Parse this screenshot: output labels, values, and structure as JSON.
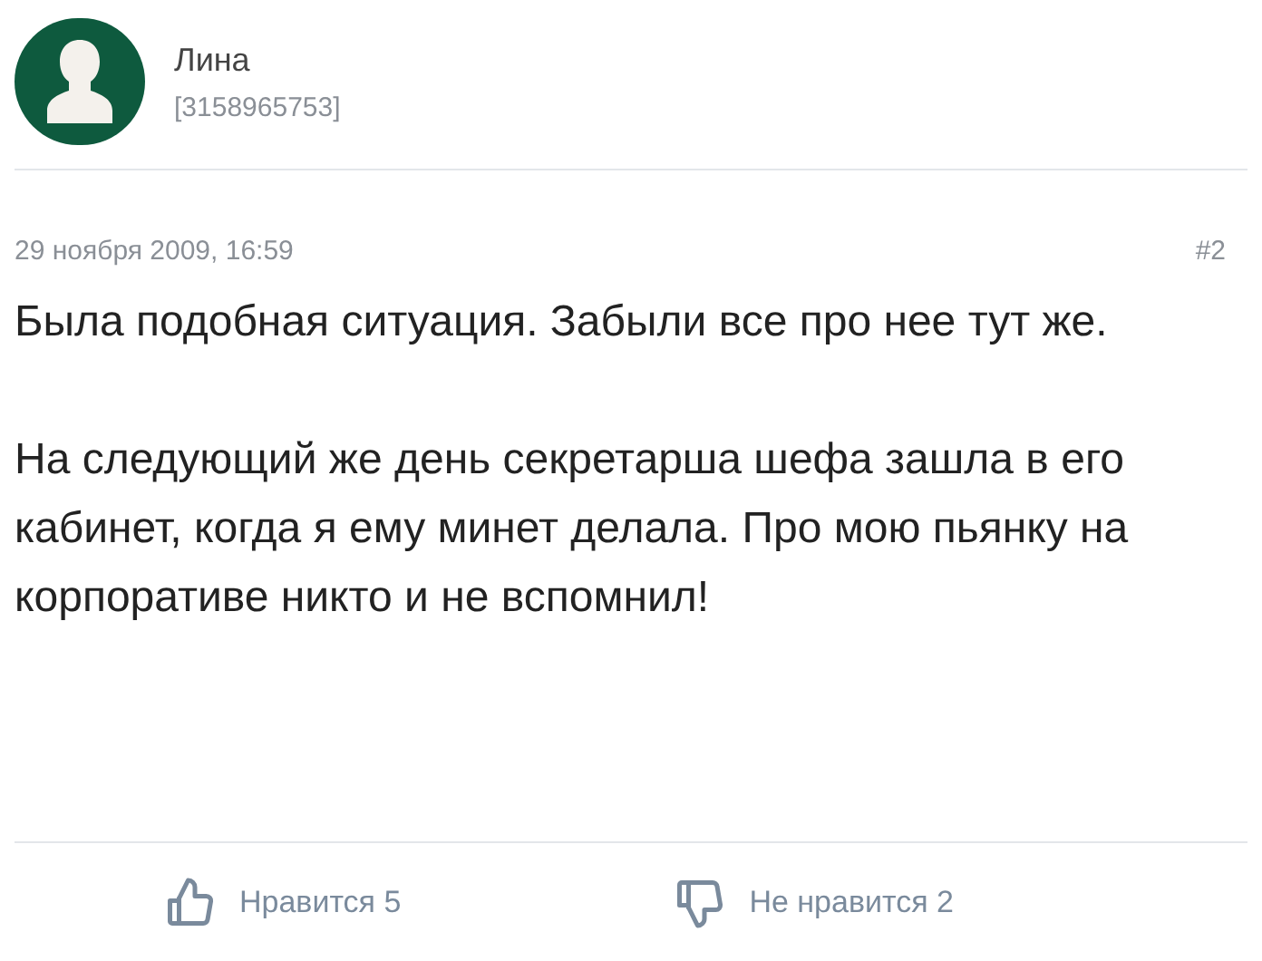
{
  "author": {
    "name": "Лина",
    "id": "[3158965753]"
  },
  "post": {
    "date": "29 ноября 2009, 16:59",
    "number": "#2",
    "paragraphs": [
      "Была подобная ситуация. Забыли все про нее тут же.",
      "На следующий же день секретарша шефа зашла в его кабинет, когда я ему минет делала. Про мою пьянку на корпоративе никто и не вспомнил!"
    ]
  },
  "reactions": [
    {
      "kind": "like",
      "label": "Нравится 5"
    },
    {
      "kind": "dislike",
      "label": "Не нравится 2"
    }
  ]
}
